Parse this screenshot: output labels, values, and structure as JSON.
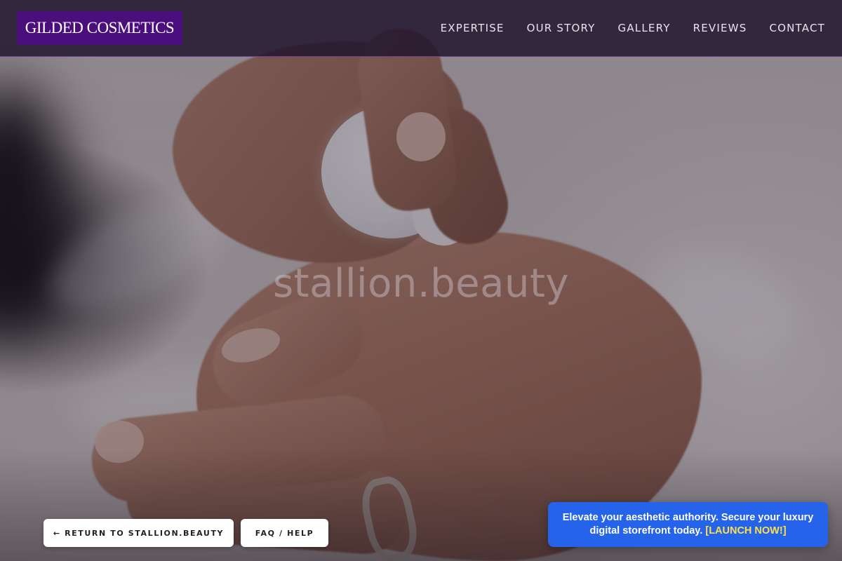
{
  "brand": {
    "logo_text": "GILDED COSMETICS"
  },
  "nav": {
    "items": [
      "EXPERTISE",
      "OUR STORY",
      "GALLERY",
      "REVIEWS",
      "CONTACT"
    ]
  },
  "hero": {
    "watermark": "stallion.beauty"
  },
  "buttons": {
    "return_label": "← RETURN TO STALLION.BEAUTY",
    "faq_label": "FAQ / HELP"
  },
  "promo": {
    "text": "Elevate your aesthetic authority. Secure your luxury digital storefront today.",
    "cta": "[LAUNCH NOW!]"
  },
  "colors": {
    "logo_bg": "#4b0f7d",
    "promo_bg": "#2563eb",
    "promo_cta": "#fde047",
    "nav_border": "#6a3d95"
  }
}
